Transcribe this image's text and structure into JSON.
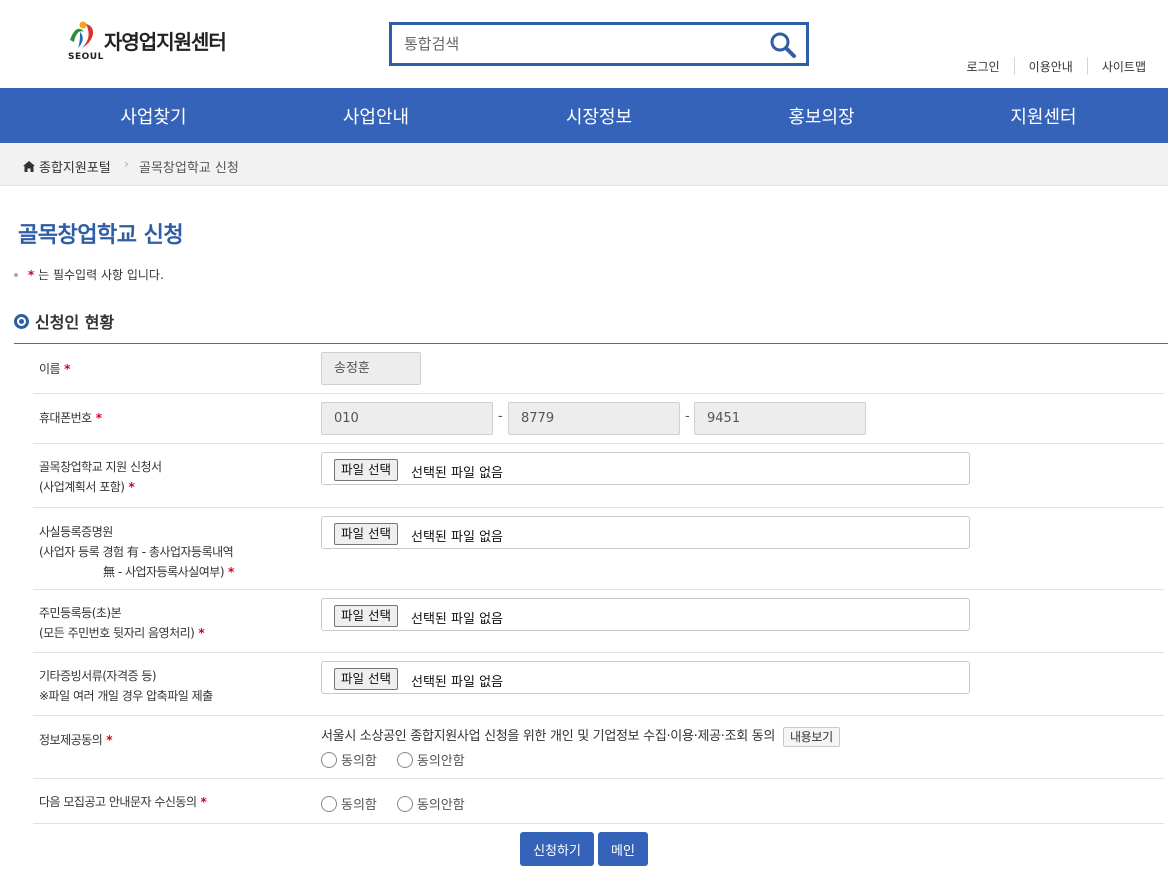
{
  "header": {
    "logo_text": "자영업지원센터",
    "logo_sub": "SEOUL",
    "search_placeholder": "통합검색",
    "util_links": [
      "로그인",
      "이용안내",
      "사이트맵"
    ]
  },
  "gnb": [
    "사업찾기",
    "사업안내",
    "시장정보",
    "홍보의장",
    "지원센터"
  ],
  "breadcrumb": {
    "home": "종합지원포털",
    "current": "골목창업학교 신청"
  },
  "page_title": "골목창업학교 신청",
  "notice": {
    "star": "*",
    "text": "는 필수입력 사항 입니다."
  },
  "section_title": "신청인 현황",
  "form": {
    "name": {
      "label": "이름",
      "value": "송정훈"
    },
    "phone": {
      "label": "휴대폰번호",
      "p1": "010",
      "p2": "8779",
      "p3": "9451",
      "sep": "-"
    },
    "file_button": "파일 선택",
    "file_status": "선택된 파일 없음",
    "doc1": {
      "line1": "골목창업학교 지원 신청서",
      "line2": "(사업계획서 포함)"
    },
    "doc2": {
      "line1": "사실등록증명원",
      "line2": "(사업자 등록 경험 有 - 총사업자등록내역",
      "line3": "無 - 사업자등록사실여부)"
    },
    "doc3": {
      "line1": "주민등록등(초)본",
      "line2": "(모든 주민번호 뒷자리 음영처리)"
    },
    "doc4": {
      "line1": "기타증빙서류(자격증 등)",
      "line2": "※파일 여러 개일 경우 압축파일 제출"
    },
    "consent": {
      "label": "정보제공동의",
      "text": "서울시 소상공인 종합지원사업 신청을 위한 개인 및 기업정보 수집·이용·제공·조회 동의",
      "detail_button": "내용보기",
      "agree": "동의함",
      "disagree": "동의안함"
    },
    "sms": {
      "label": "다음 모집공고 안내문자 수신동의",
      "agree": "동의함",
      "disagree": "동의안함"
    }
  },
  "buttons": {
    "submit": "신청하기",
    "main": "메인"
  }
}
